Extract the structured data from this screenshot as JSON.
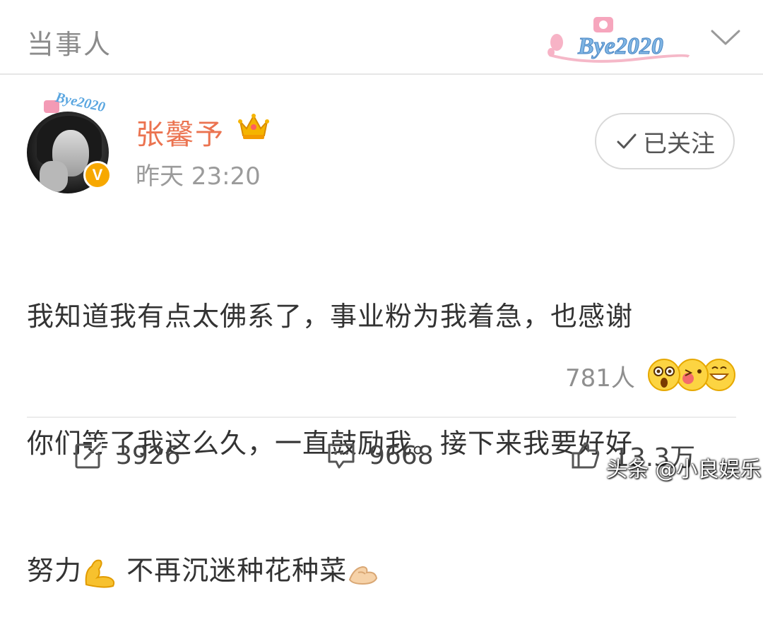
{
  "header": {
    "title": "当事人",
    "badge_text": "Bye2020"
  },
  "post": {
    "author": {
      "name": "张馨予",
      "avatar_badge_text": "Bye2020",
      "verified_letter": "V"
    },
    "timestamp": "昨天 23:20",
    "follow_button": {
      "label": "已关注",
      "icon": "checkmark-icon"
    },
    "content": {
      "line1": "我知道我有点太佛系了，事业粉为我着急，也感谢",
      "line2": "你们等了我这么久，一直鼓励我。接下来我要好好",
      "line3_a": "努力",
      "line3_b": " 不再沉迷种花种菜",
      "emoji_1": "flexed-biceps-emoji",
      "emoji_2": "pinching-hands-emoji"
    },
    "reactions": {
      "count_label": "781人",
      "emojis": [
        "surprised-face-emoji",
        "kissing-face-emoji",
        "grinning-face-emoji"
      ]
    },
    "actions": {
      "repost_count": "3926",
      "comment_count": "9668",
      "like_count": "13.3万"
    }
  },
  "watermark": "头条 @小良娱乐",
  "colors": {
    "username": "#eb7350",
    "verified": "#f7a800",
    "text": "#333333",
    "muted": "#9b9b9b"
  }
}
